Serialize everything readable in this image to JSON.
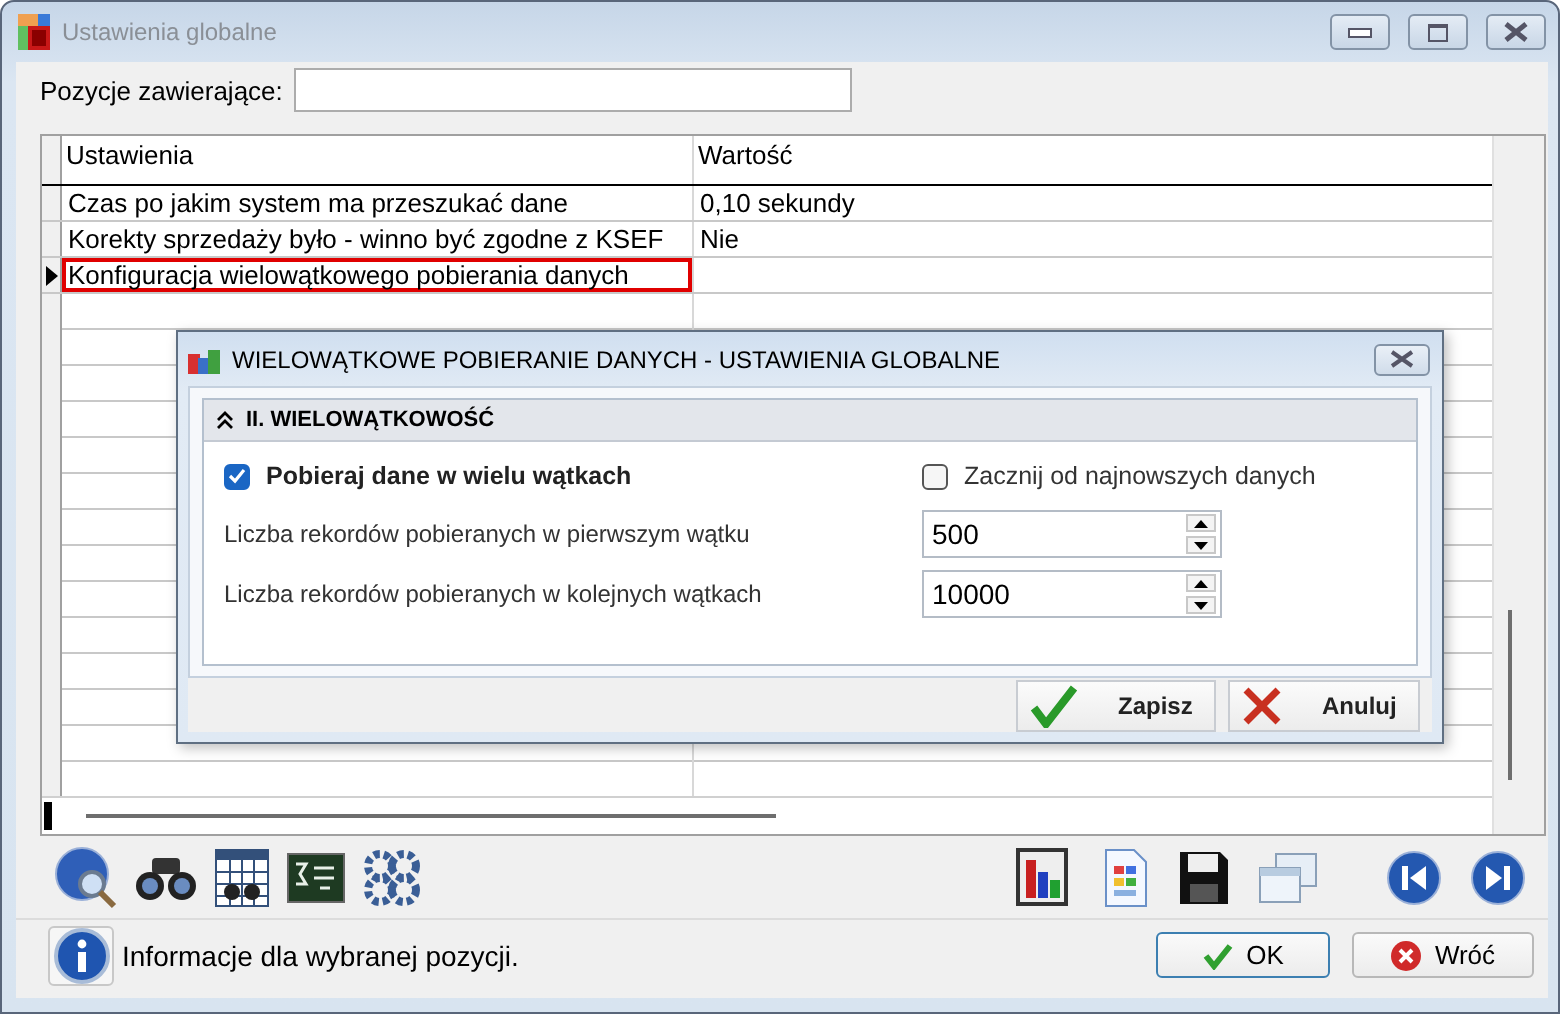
{
  "window": {
    "title": "Ustawienia globalne"
  },
  "filter": {
    "label": "Pozycje zawierające:"
  },
  "grid": {
    "columns": [
      "Ustawienia",
      "Wartość"
    ],
    "rows": [
      {
        "setting": "Czas po jakim system ma przeszukać dane",
        "value": "0,10 sekundy",
        "selected": false
      },
      {
        "setting": "Korekty sprzedaży było - winno być zgodne z KSEF",
        "value": "Nie",
        "selected": false
      },
      {
        "setting": "Konfiguracja wielowątkowego pobierania danych",
        "selected": true
      }
    ]
  },
  "dialog": {
    "title": "WIELOWĄTKOWE POBIERANIE DANYCH - USTAWIENIA GLOBALNE",
    "section": {
      "title": "II. WIELOWĄTKOWOŚĆ",
      "expanded": true
    },
    "options": [
      {
        "label": "Pobieraj dane w wielu wątkach",
        "checked": true
      },
      {
        "label": "Zacznij od najnowszych danych",
        "checked": false
      }
    ],
    "fields": [
      {
        "label": "Liczba rekordów pobieranych w pierwszym wątku",
        "value": "500"
      },
      {
        "label": "Liczba rekordów pobieranych w kolejnych wątkach",
        "value": "10000"
      }
    ],
    "buttons": [
      {
        "label": "Zapisz",
        "kind": "save"
      },
      {
        "label": "Anuluj",
        "kind": "cancel"
      }
    ]
  },
  "footer": {
    "info": "Informacje dla wybranej pozycji.",
    "buttons": [
      {
        "label": "OK",
        "kind": "ok"
      },
      {
        "label": "Wróć",
        "kind": "back"
      }
    ]
  }
}
